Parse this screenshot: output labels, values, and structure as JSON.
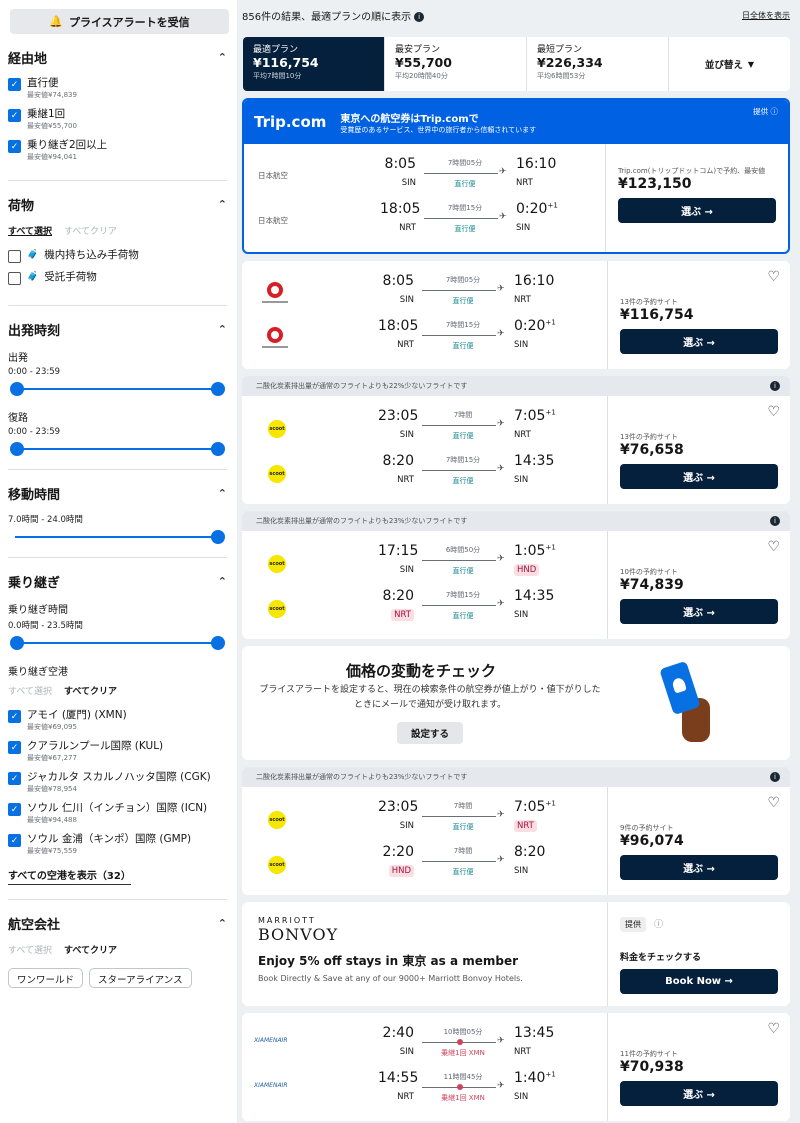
{
  "sidebar": {
    "price_alert_label": "プライスアラートを受信",
    "stops": {
      "title": "経由地",
      "items": [
        {
          "label": "直行便",
          "sub": "最安値¥74,839",
          "checked": true
        },
        {
          "label": "乗継1回",
          "sub": "最安値¥55,700",
          "checked": true
        },
        {
          "label": "乗り継ぎ2回以上",
          "sub": "最安値¥94,041",
          "checked": true
        }
      ]
    },
    "baggage": {
      "title": "荷物",
      "select_all": "すべて選択",
      "clear_all": "すべてクリア",
      "items": [
        {
          "label": "機内持ち込み手荷物",
          "checked": false
        },
        {
          "label": "受託手荷物",
          "checked": false
        }
      ]
    },
    "departure": {
      "title": "出発時刻",
      "outbound_label": "出発",
      "outbound_range": "0:00 - 23:59",
      "return_label": "復路",
      "return_range": "0:00 - 23:59"
    },
    "duration": {
      "title": "移動時間",
      "range": "7.0時間 - 24.0時間"
    },
    "connections": {
      "title": "乗り継ぎ",
      "time_label": "乗り継ぎ時間",
      "time_range": "0.0時間 - 23.5時間",
      "airports_label": "乗り継ぎ空港",
      "select_all": "すべて選択",
      "clear_all": "すべてクリア",
      "airports": [
        {
          "label": "アモイ (厦門) (XMN)",
          "sub": "最安値¥69,095",
          "checked": true
        },
        {
          "label": "クアラルンプール国際 (KUL)",
          "sub": "最安値¥67,277",
          "checked": true
        },
        {
          "label": "ジャカルタ スカルノハッタ国際 (CGK)",
          "sub": "最安値¥78,954",
          "checked": true
        },
        {
          "label": "ソウル 仁川（インチョン）国際 (ICN)",
          "sub": "最安値¥94,488",
          "checked": true
        },
        {
          "label": "ソウル 金浦（キンポ）国際 (GMP)",
          "sub": "最安値¥75,559",
          "checked": true
        }
      ],
      "show_all": "すべての空港を表示（32）"
    },
    "airlines": {
      "title": "航空会社",
      "select_all": "すべて選択",
      "clear_all": "すべてクリア",
      "chips": [
        "ワンワールド",
        "スターアライアンス"
      ]
    }
  },
  "results": {
    "summary": "856件の結果、最適プランの順に表示",
    "show_all_days": "日全体を表示",
    "sort_tabs": [
      {
        "name": "最適プラン",
        "price": "¥116,754",
        "sub": "平均7時間10分",
        "active": true
      },
      {
        "name": "最安プラン",
        "price": "¥55,700",
        "sub": "平均20時間40分",
        "active": false
      },
      {
        "name": "最短プラン",
        "price": "¥226,334",
        "sub": "平均6時間53分",
        "active": false
      }
    ],
    "sort_select": "並び替え"
  },
  "trip_ad": {
    "logo": "Trip.com",
    "title": "東京への航空券はTrip.comで",
    "subtitle": "受賞歴のあるサービス、世界中の旅行者から信頼されています",
    "ad_label": "提供",
    "legs": [
      {
        "airline": "日本航空",
        "dep": "8:05",
        "dep_code": "SIN",
        "dur": "7時間05分",
        "stops": "直行便",
        "arr": "16:10",
        "arr_sup": "",
        "arr_code": "NRT"
      },
      {
        "airline": "日本航空",
        "dep": "18:05",
        "dep_code": "NRT",
        "dur": "7時間15分",
        "stops": "直行便",
        "arr": "0:20",
        "arr_sup": "+1",
        "arr_code": "SIN"
      }
    ],
    "deal_sites": "Trip.com(トリップドットコム)で予約、最安値",
    "price": "¥123,150",
    "button": "選ぶ →"
  },
  "flights": [
    {
      "eco": "",
      "airline": "jal",
      "legs": [
        {
          "dep": "8:05",
          "dep_code": "SIN",
          "dur": "7時間05分",
          "stops": "直行便",
          "arr": "16:10",
          "arr_sup": "",
          "arr_code": "NRT"
        },
        {
          "dep": "18:05",
          "dep_code": "NRT",
          "dur": "7時間15分",
          "stops": "直行便",
          "arr": "0:20",
          "arr_sup": "+1",
          "arr_code": "SIN"
        }
      ],
      "sites": "13件の予約サイト",
      "price": "¥116,754",
      "button": "選ぶ →"
    },
    {
      "eco": "二酸化炭素排出量が通常のフライトよりも22%少ないフライトです",
      "airline": "scoot",
      "legs": [
        {
          "dep": "23:05",
          "dep_code": "SIN",
          "dur": "7時間",
          "stops": "直行便",
          "arr": "7:05",
          "arr_sup": "+1",
          "arr_code": "NRT"
        },
        {
          "dep": "8:20",
          "dep_code": "NRT",
          "dur": "7時間15分",
          "stops": "直行便",
          "arr": "14:35",
          "arr_sup": "",
          "arr_code": "SIN"
        }
      ],
      "sites": "13件の予約サイト",
      "price": "¥76,658",
      "button": "選ぶ →"
    },
    {
      "eco": "二酸化炭素排出量が通常のフライトよりも23%少ないフライトです",
      "airline": "scoot",
      "legs": [
        {
          "dep": "17:15",
          "dep_code": "SIN",
          "dur": "6時間50分",
          "stops": "直行便",
          "arr": "1:05",
          "arr_sup": "+1",
          "arr_code": "HND",
          "arr_hl": true
        },
        {
          "dep": "8:20",
          "dep_code": "NRT",
          "dep_hl": true,
          "dur": "7時間15分",
          "stops": "直行便",
          "arr": "14:35",
          "arr_sup": "",
          "arr_code": "SIN"
        }
      ],
      "sites": "10件の予約サイト",
      "price": "¥74,839",
      "button": "選ぶ →"
    }
  ],
  "price_alert_card": {
    "title": "価格の変動をチェック",
    "body": "プライスアラートを設定すると、現在の検索条件の航空券が値上がり・値下がりしたときにメールで通知が受け取れます。",
    "button": "設定する"
  },
  "flight4": {
    "eco": "二酸化炭素排出量が通常のフライトよりも23%少ないフライトです",
    "airline": "scoot",
    "legs": [
      {
        "dep": "23:05",
        "dep_code": "SIN",
        "dur": "7時間",
        "stops": "直行便",
        "arr": "7:05",
        "arr_sup": "+1",
        "arr_code": "NRT",
        "arr_hl": true
      },
      {
        "dep": "2:20",
        "dep_code": "HND",
        "dep_hl": true,
        "dur": "7時間",
        "stops": "直行便",
        "arr": "8:20",
        "arr_sup": "",
        "arr_code": "SIN"
      }
    ],
    "sites": "9件の予約サイト",
    "price": "¥96,074",
    "button": "選ぶ →"
  },
  "marriott": {
    "logo_top": "MARRIOTT",
    "logo_main": "BONVOY",
    "title": "Enjoy 5% off stays in 東京 as a member",
    "subtitle": "Book Directly & Save at any of our 9000+ Marriott Bonvoy Hotels.",
    "ad_label": "提供",
    "check": "料金をチェックする",
    "button": "Book Now →"
  },
  "flight5": {
    "airline": "xiamen",
    "airline_name": "XIAMENAIR",
    "legs": [
      {
        "dep": "2:40",
        "dep_code": "SIN",
        "dur": "10時間05分",
        "stops": "乗継1回 XMN",
        "arr": "13:45",
        "arr_sup": "",
        "arr_code": "NRT"
      },
      {
        "dep": "14:55",
        "dep_code": "NRT",
        "dur": "11時間45分",
        "stops": "乗継1回 XMN",
        "arr": "1:40",
        "arr_sup": "+1",
        "arr_code": "SIN"
      }
    ],
    "sites": "11件の予約サイト",
    "price": "¥70,938",
    "button": "選ぶ →"
  },
  "colors": {
    "accent": "#0770e3",
    "dark": "#05203c",
    "trip_blue": "#0062e3",
    "eco_bg": "#e5e8ec"
  }
}
